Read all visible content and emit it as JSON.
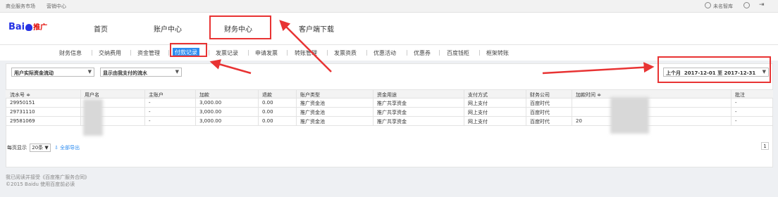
{
  "topbar": {
    "left_links": [
      "商业服务市场",
      "营销中心"
    ],
    "user_name": "未名智库",
    "icons": [
      "user-icon",
      "minus-circle-icon",
      "logout-icon"
    ]
  },
  "header": {
    "logo_text": "Bai",
    "logo_text2": "推广",
    "nav": [
      "首页",
      "账户中心",
      "财务中心",
      "客户端下载"
    ],
    "active_nav": "财务中心"
  },
  "subnav": {
    "items": [
      "财务信息",
      "交纳费用",
      "资金管理",
      "付款记录",
      "发票记录",
      "申请发票",
      "转账管理",
      "发票资质",
      "优惠活动",
      "优惠券",
      "百度钱柜",
      "框架转账"
    ],
    "active": "付款记录"
  },
  "filters": {
    "flow_type": "用户实际资金流动",
    "display_mode": "显示由我支付的流水",
    "date_preset": "上个月",
    "date_range": "2017-12-01 至 2017-12-31"
  },
  "table": {
    "headers": [
      "流水号 ≑",
      "用户名",
      "主账户",
      "加款",
      "退款",
      "账户类型",
      "资金用途",
      "支付方式",
      "财务公司",
      "加款时间 ≑",
      "批注"
    ],
    "rows": [
      [
        "29950151",
        "",
        "-",
        "3,000.00",
        "0.00",
        "推广资金池",
        "推广共享资金",
        "网上支付",
        "百度时代",
        "",
        "-"
      ],
      [
        "29731110",
        "",
        "-",
        "3,000.00",
        "0.00",
        "推广资金池",
        "推广共享资金",
        "网上支付",
        "百度时代",
        "",
        "-"
      ],
      [
        "29581069",
        "",
        "-",
        "3,000.00",
        "0.00",
        "推广资金池",
        "推广共享资金",
        "网上支付",
        "百度时代",
        "20",
        "-"
      ]
    ]
  },
  "pager": {
    "per_page_label": "每页显示",
    "per_page_value": "20条",
    "export_label": "全部导出",
    "current_page": "1"
  },
  "footer": {
    "line1": "我已阅读并接受《百度推广服务合同》",
    "line2": "©2015 Baidu 使用百度前必读"
  },
  "colors": {
    "accent": "#2d8cf0",
    "annotation": "#e83333",
    "brand_blue": "#2532e4",
    "brand_red": "#e10601"
  }
}
